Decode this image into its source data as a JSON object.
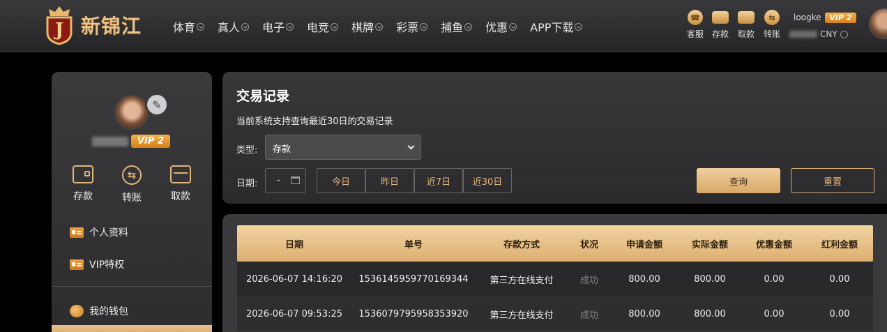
{
  "brand": {
    "name": "新锦江",
    "logo_letter": "J"
  },
  "nav": [
    {
      "label": "体育"
    },
    {
      "label": "真人"
    },
    {
      "label": "电子"
    },
    {
      "label": "电竞"
    },
    {
      "label": "棋牌"
    },
    {
      "label": "彩票"
    },
    {
      "label": "捕鱼"
    },
    {
      "label": "优惠"
    },
    {
      "label": "APP下载"
    }
  ],
  "quick_actions": [
    {
      "label": "客服",
      "icon": "headset-icon",
      "glyph": "☎"
    },
    {
      "label": "存款",
      "icon": "wallet-icon",
      "glyph": ""
    },
    {
      "label": "取款",
      "icon": "cash-icon",
      "glyph": ""
    },
    {
      "label": "转账",
      "icon": "transfer-icon",
      "glyph": "⇆"
    }
  ],
  "user": {
    "username": "loogke",
    "vip": "VIP 2",
    "currency": "CNY"
  },
  "sidebar": {
    "vip": "VIP 2",
    "actions": [
      {
        "label": "存款",
        "icon": "deposit-icon"
      },
      {
        "label": "转账",
        "icon": "transfer-icon"
      },
      {
        "label": "取款",
        "icon": "withdraw-icon"
      }
    ],
    "menu": [
      {
        "label": "个人资料",
        "icon": "profile-card-icon"
      },
      {
        "label": "VIP特权",
        "icon": "vip-card-icon"
      }
    ],
    "wallet_label": "我的钱包"
  },
  "query": {
    "title": "交易记录",
    "subtitle": "当前系统支持查询最近30日的交易记录",
    "type_label": "类型:",
    "type_value": "存款",
    "date_label": "日期:",
    "date_value": "-",
    "ranges": [
      {
        "label": "今日"
      },
      {
        "label": "昨日"
      },
      {
        "label": "近7日"
      },
      {
        "label": "近30日"
      }
    ],
    "query_button": "查询",
    "reset_button": "重置"
  },
  "table": {
    "headers": [
      "日期",
      "单号",
      "存款方式",
      "状况",
      "申请金额",
      "实际金额",
      "优惠金额",
      "红利金额"
    ],
    "rows": [
      [
        "2026-06-07 14:16:20",
        "1536145959770169344",
        "第三方在线支付",
        "成功",
        "800.00",
        "800.00",
        "0.00",
        "0.00"
      ],
      [
        "2026-06-07 09:53:25",
        "1536079795958353920",
        "第三方在线支付",
        "成功",
        "800.00",
        "800.00",
        "0.00",
        "0.00"
      ]
    ]
  },
  "colors": {
    "accent_gold": "#e2b57a",
    "vip_orange": "#e08b22",
    "panel": "#38383a"
  }
}
